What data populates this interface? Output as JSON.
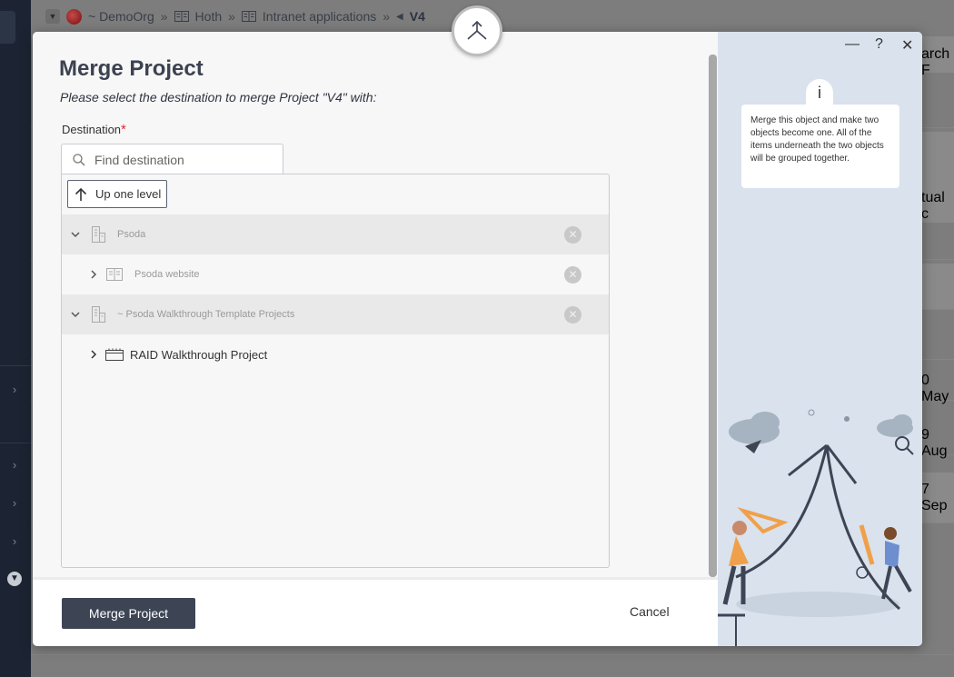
{
  "breadcrumb": {
    "items": [
      "~ DemoOrg",
      "Hoth",
      "Intranet applications",
      "V4"
    ],
    "separator": "»"
  },
  "background": {
    "right_texts": [
      "arch F",
      "tual c",
      "0 May",
      "9 Aug",
      "7 Sep"
    ]
  },
  "modal": {
    "title": "Merge Project",
    "subtitle": "Please select the destination to merge Project \"V4\" with:",
    "destination_label": "Destination",
    "required_mark": "*",
    "search_placeholder": "Find destination",
    "up_one_level_label": "Up one level",
    "tree": [
      {
        "label": "Psoda",
        "icon": "building-icon",
        "level": 0,
        "expanded": true,
        "disabled": true
      },
      {
        "label": "Psoda website",
        "icon": "book-icon",
        "level": 1,
        "expanded": false,
        "disabled": true
      },
      {
        "label": "~ Psoda Walkthrough Template Projects",
        "icon": "building-icon",
        "level": 0,
        "expanded": true,
        "disabled": true
      },
      {
        "label": "RAID Walkthrough Project",
        "icon": "project-icon",
        "level": 1,
        "expanded": false,
        "disabled": false
      }
    ],
    "merge_button_label": "Merge Project",
    "cancel_label": "Cancel"
  },
  "side_panel": {
    "info_symbol": "i",
    "info_text": "Merge this object and make two objects become one. All of the items underneath the two objects will be grouped together.",
    "controls": {
      "minimize": "—",
      "help": "?",
      "close": "✕"
    }
  },
  "colors": {
    "accent_dark": "#3d4555",
    "side_panel_bg": "#d9e2ed",
    "required": "#d83030",
    "illustration_orange": "#f0a04a"
  }
}
